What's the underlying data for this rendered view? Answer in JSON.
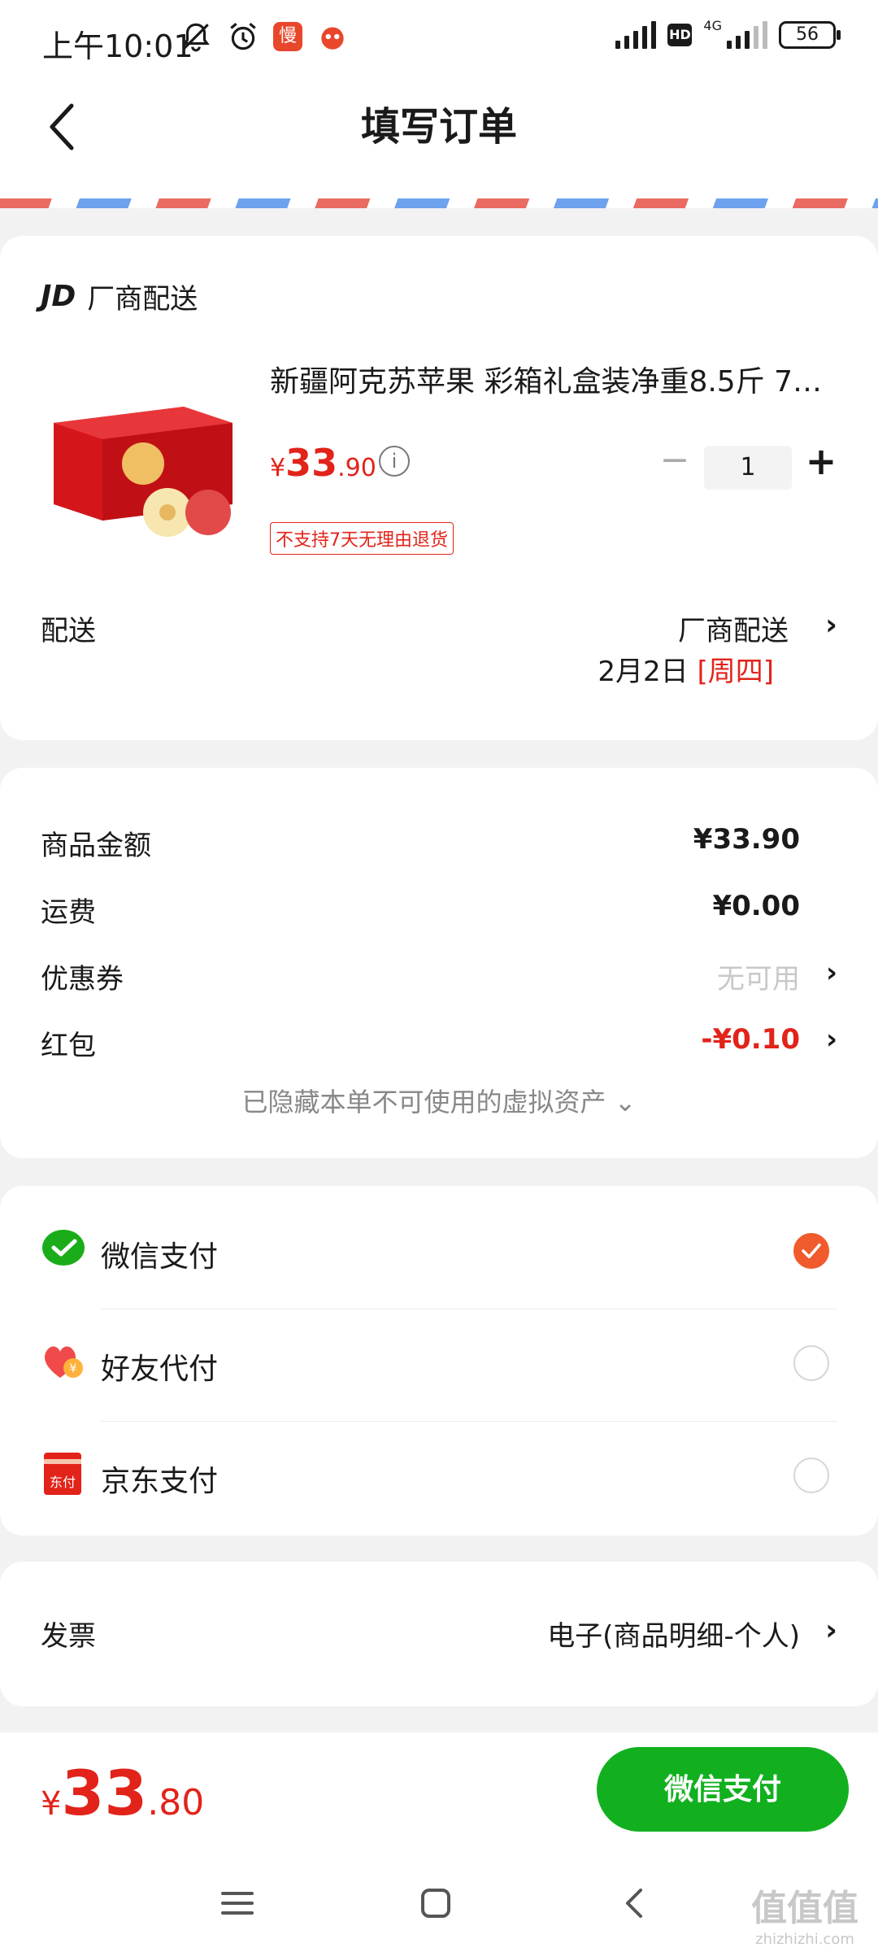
{
  "status_bar": {
    "time": "上午10:01",
    "app_badge": "慢",
    "network": "4G",
    "hd": "HD",
    "battery": "56"
  },
  "header": {
    "title": "填写订单"
  },
  "product_card": {
    "seller_logo": "JD",
    "seller_name": "厂商配送",
    "product_name": "新疆阿克苏苹果 彩箱礼盒装净重8.5斤 75...",
    "price_symbol": "¥",
    "price_int": "33",
    "price_dec": ".90",
    "quantity": "1",
    "return_policy": "不支持7天无理由退货",
    "delivery_label": "配送",
    "delivery_method": "厂商配送",
    "delivery_date": "2月2日",
    "delivery_weekday": "[周四]"
  },
  "amount_card": {
    "rows": [
      {
        "label": "商品金额",
        "value": "¥33.90"
      },
      {
        "label": "运费",
        "value": "¥0.00"
      },
      {
        "label": "优惠券",
        "value": "无可用"
      },
      {
        "label": "红包",
        "value": "-¥0.10"
      }
    ],
    "hidden_assets": "已隐藏本单不可使用的虚拟资产 ⌄"
  },
  "payment_card": {
    "methods": [
      {
        "label": "微信支付",
        "selected": true
      },
      {
        "label": "好友代付",
        "selected": false
      },
      {
        "label": "京东支付",
        "selected": false
      }
    ]
  },
  "invoice_card": {
    "label": "发票",
    "value": "电子(商品明细-个人)"
  },
  "bottom_bar": {
    "total_symbol": "¥",
    "total_int": "33",
    "total_dec": ".80",
    "pay_button": "微信支付"
  },
  "watermark": {
    "text": "值值值",
    "url": "zhizhizhi.com"
  },
  "colors": {
    "price_red": "#e2231a",
    "pay_green": "#12b01f",
    "selected_orange": "#f15a2b"
  }
}
